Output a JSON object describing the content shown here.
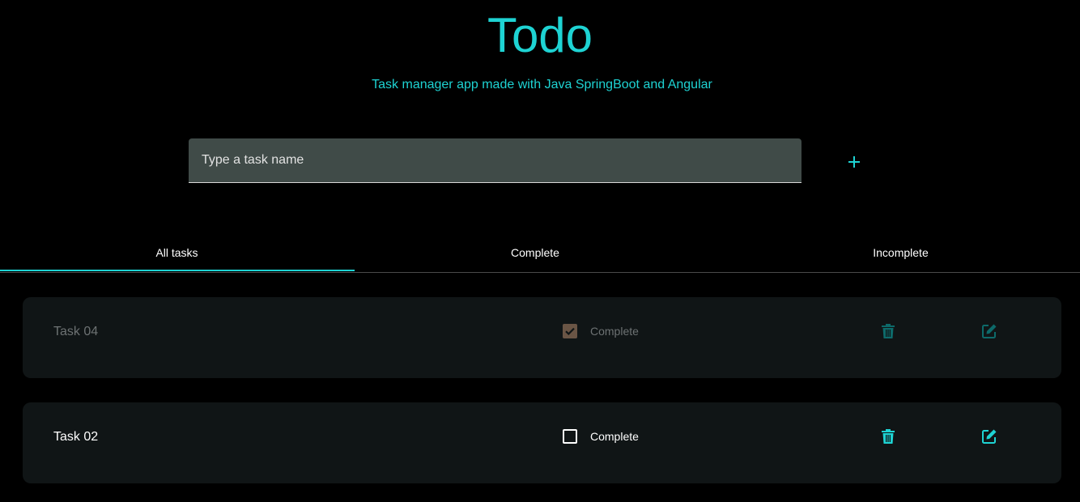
{
  "header": {
    "title": "Todo",
    "subtitle": "Task manager app made with Java SpringBoot and Angular"
  },
  "new_task": {
    "placeholder": "Type a task name",
    "add_icon": "plus-icon"
  },
  "tabs": [
    {
      "label": "All tasks",
      "active": true
    },
    {
      "label": "Complete",
      "active": false
    },
    {
      "label": "Incomplete",
      "active": false
    }
  ],
  "tasks": [
    {
      "name": "Task 04",
      "complete": true,
      "status_label": "Complete",
      "delete_icon": "trash-icon",
      "edit_icon": "edit-icon"
    },
    {
      "name": "Task 02",
      "complete": false,
      "status_label": "Complete",
      "delete_icon": "trash-icon",
      "edit_icon": "edit-icon"
    }
  ],
  "colors": {
    "accent": "#1ed3d3",
    "accent_dim": "#0d6a6a",
    "background": "#000000",
    "card": "#101516",
    "input_bg": "#404b48",
    "checked_box": "#6a5545"
  }
}
